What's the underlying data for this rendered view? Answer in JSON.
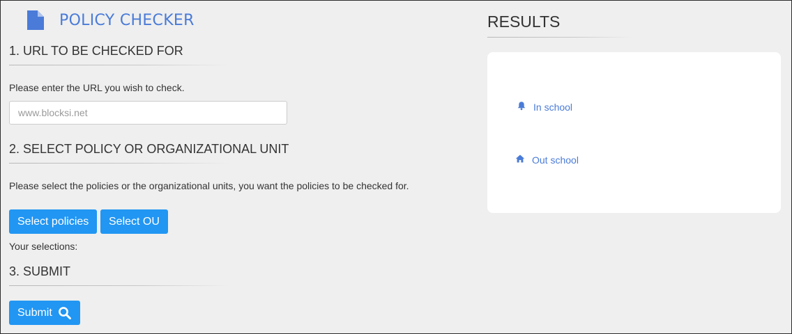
{
  "app": {
    "title": "POLICY CHECKER",
    "icon": "document-icon"
  },
  "colors": {
    "accent": "#4a7bd8",
    "button": "#2196f3",
    "background": "#efefef",
    "panel": "#ffffff"
  },
  "section1": {
    "heading": "1. URL TO BE CHECKED FOR",
    "help": "Please enter the URL you wish to check.",
    "url_input": {
      "placeholder": "www.blocksi.net",
      "value": ""
    }
  },
  "section2": {
    "heading": "2. SELECT POLICY OR ORGANIZATIONAL UNIT",
    "help": "Please select the policies or the organizational units, you want the policies to be checked for.",
    "select_policies_label": "Select policies",
    "select_ou_label": "Select OU",
    "selections_label": "Your selections:"
  },
  "section3": {
    "heading": "3. SUBMIT",
    "submit_label": "Submit",
    "submit_icon": "search-icon"
  },
  "results": {
    "title": "RESULTS",
    "items": [
      {
        "label": "In school",
        "icon": "bell-icon"
      },
      {
        "label": "Out school",
        "icon": "home-icon"
      }
    ]
  }
}
